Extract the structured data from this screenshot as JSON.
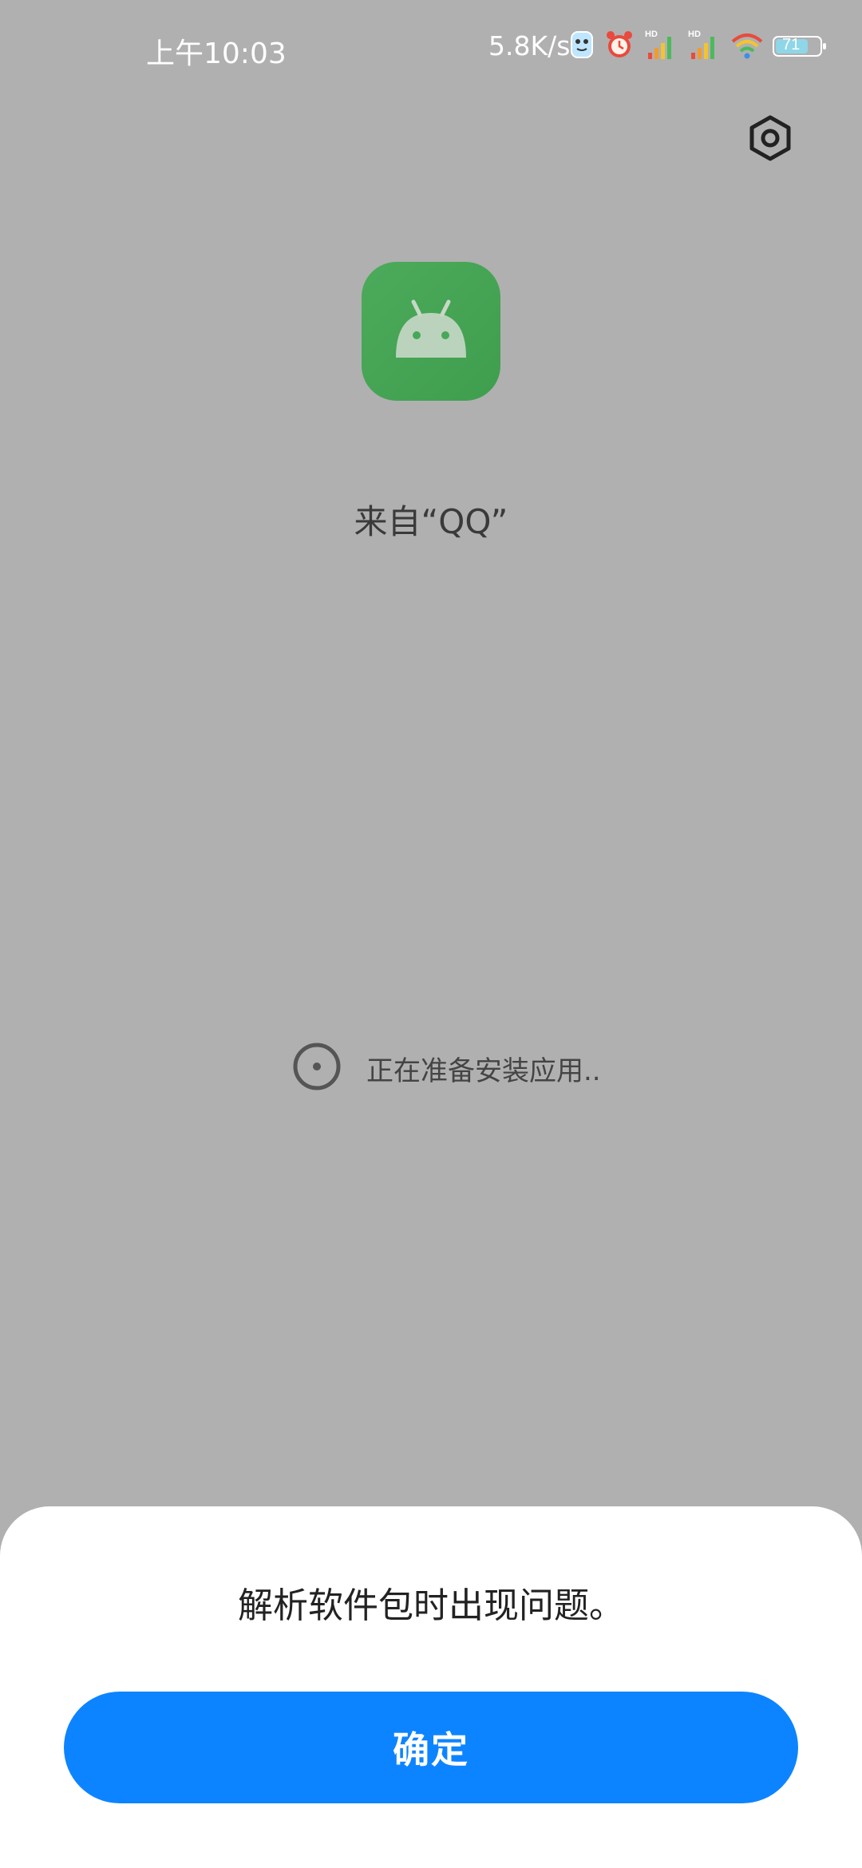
{
  "status_bar": {
    "time": "上午10:03",
    "network_speed": "5.8K/s",
    "battery_level": "71",
    "icons": [
      "robot-face-icon",
      "alarm-clock-icon",
      "signal-hd-1-icon",
      "signal-hd-2-icon",
      "wifi-icon",
      "battery-icon"
    ]
  },
  "header": {
    "settings_icon": "gear-icon"
  },
  "app": {
    "icon": "android-icon",
    "icon_color": "#47a857",
    "source_label": "来自“QQ”"
  },
  "progress": {
    "icon": "loading-circle-icon",
    "text": "正在准备安装应用.."
  },
  "dialog": {
    "message": "解析软件包时出现问题。",
    "confirm_label": "确定",
    "confirm_color": "#0d84ff"
  }
}
